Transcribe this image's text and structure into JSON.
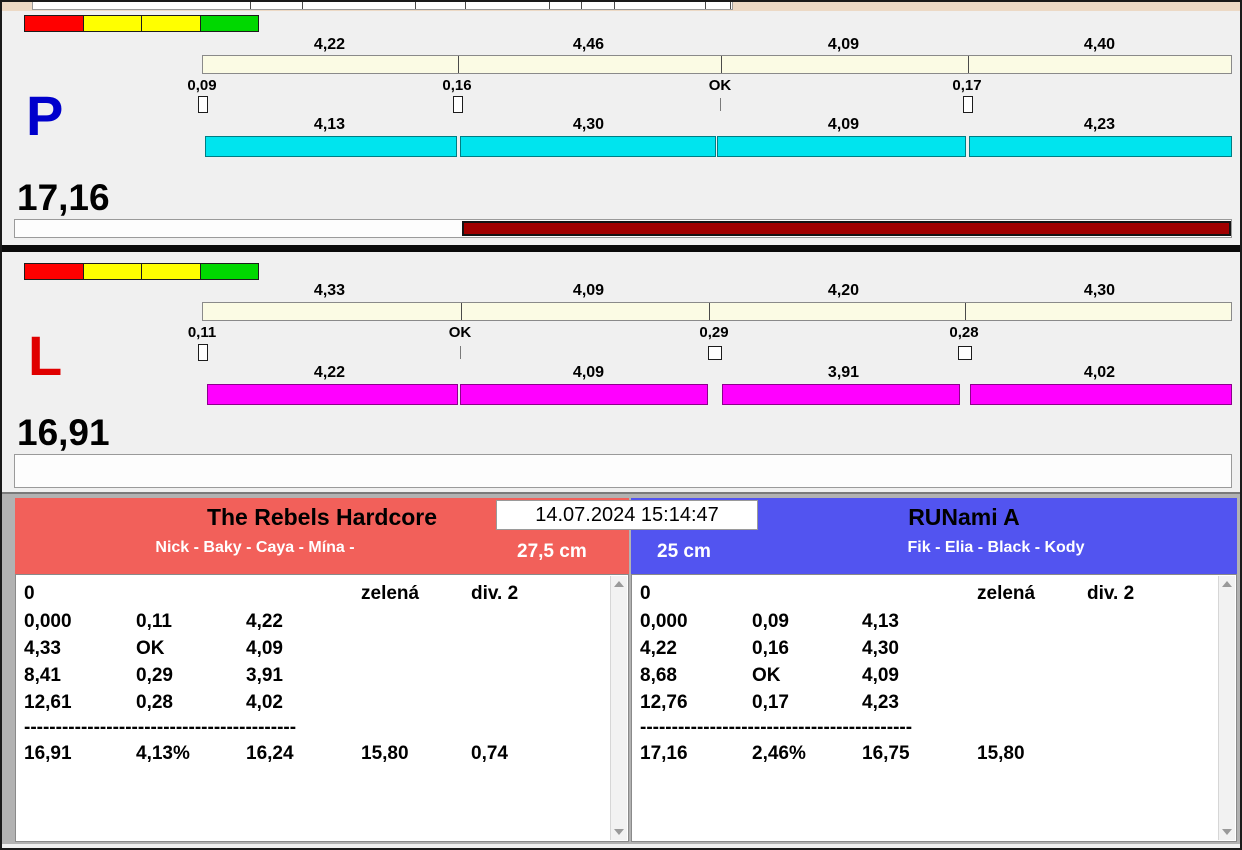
{
  "datetime": "14.07.2024 15:14:47",
  "lane_p": {
    "label": "P",
    "label_color": "#0000cc",
    "total": "17,16",
    "lights": [
      "#ff0000",
      "#ffff00",
      "#ffff00",
      "#00d800"
    ],
    "top_segments": [
      "4,22",
      "4,46",
      "4,09",
      "4,40"
    ],
    "changes": [
      "0,09",
      "0,16",
      "OK",
      "0,17"
    ],
    "bottom_segments": [
      "4,13",
      "4,30",
      "4,09",
      "4,23"
    ],
    "bar_color": "#00e4ee",
    "progress_color": "#a00000"
  },
  "lane_l": {
    "label": "L",
    "label_color": "#e00000",
    "total": "16,91",
    "lights": [
      "#ff0000",
      "#ffff00",
      "#ffff00",
      "#00d800"
    ],
    "top_segments": [
      "4,33",
      "4,09",
      "4,20",
      "4,30"
    ],
    "changes": [
      "0,11",
      "OK",
      "0,29",
      "0,28"
    ],
    "bottom_segments": [
      "4,22",
      "4,09",
      "3,91",
      "4,02"
    ],
    "bar_color": "#ff00ff"
  },
  "team_left": {
    "name": "The Rebels Hardcore",
    "members": "Nick - Baky - Caya - Mína -",
    "jump_height": "27,5 cm",
    "header_color": "#f2605a",
    "info_row": {
      "col1": "0",
      "col2": "zelená",
      "col3": "div. 2"
    },
    "rows": [
      [
        "0,000",
        "0,11",
        "4,22"
      ],
      [
        "4,33",
        "OK",
        "4,09"
      ],
      [
        "8,41",
        "0,29",
        "3,91"
      ],
      [
        "12,61",
        "0,28",
        "4,02"
      ]
    ],
    "separator": "-------------------------------------------",
    "summary": [
      "16,91",
      "4,13%",
      "16,24",
      "15,80",
      "0,74"
    ]
  },
  "team_right": {
    "name": "RUNami A",
    "members": "Fik - Elia - Black - Kody",
    "jump_height": "25 cm",
    "header_color": "#5254f0",
    "info_row": {
      "col1": "0",
      "col2": "zelená",
      "col3": "div. 2"
    },
    "rows": [
      [
        "0,000",
        "0,09",
        "4,13"
      ],
      [
        "4,22",
        "0,16",
        "4,30"
      ],
      [
        "8,68",
        "OK",
        "4,09"
      ],
      [
        "12,76",
        "0,17",
        "4,23"
      ]
    ],
    "separator": "-------------------------------------------",
    "summary": [
      "17,16",
      "2,46%",
      "16,75",
      "15,80"
    ]
  }
}
